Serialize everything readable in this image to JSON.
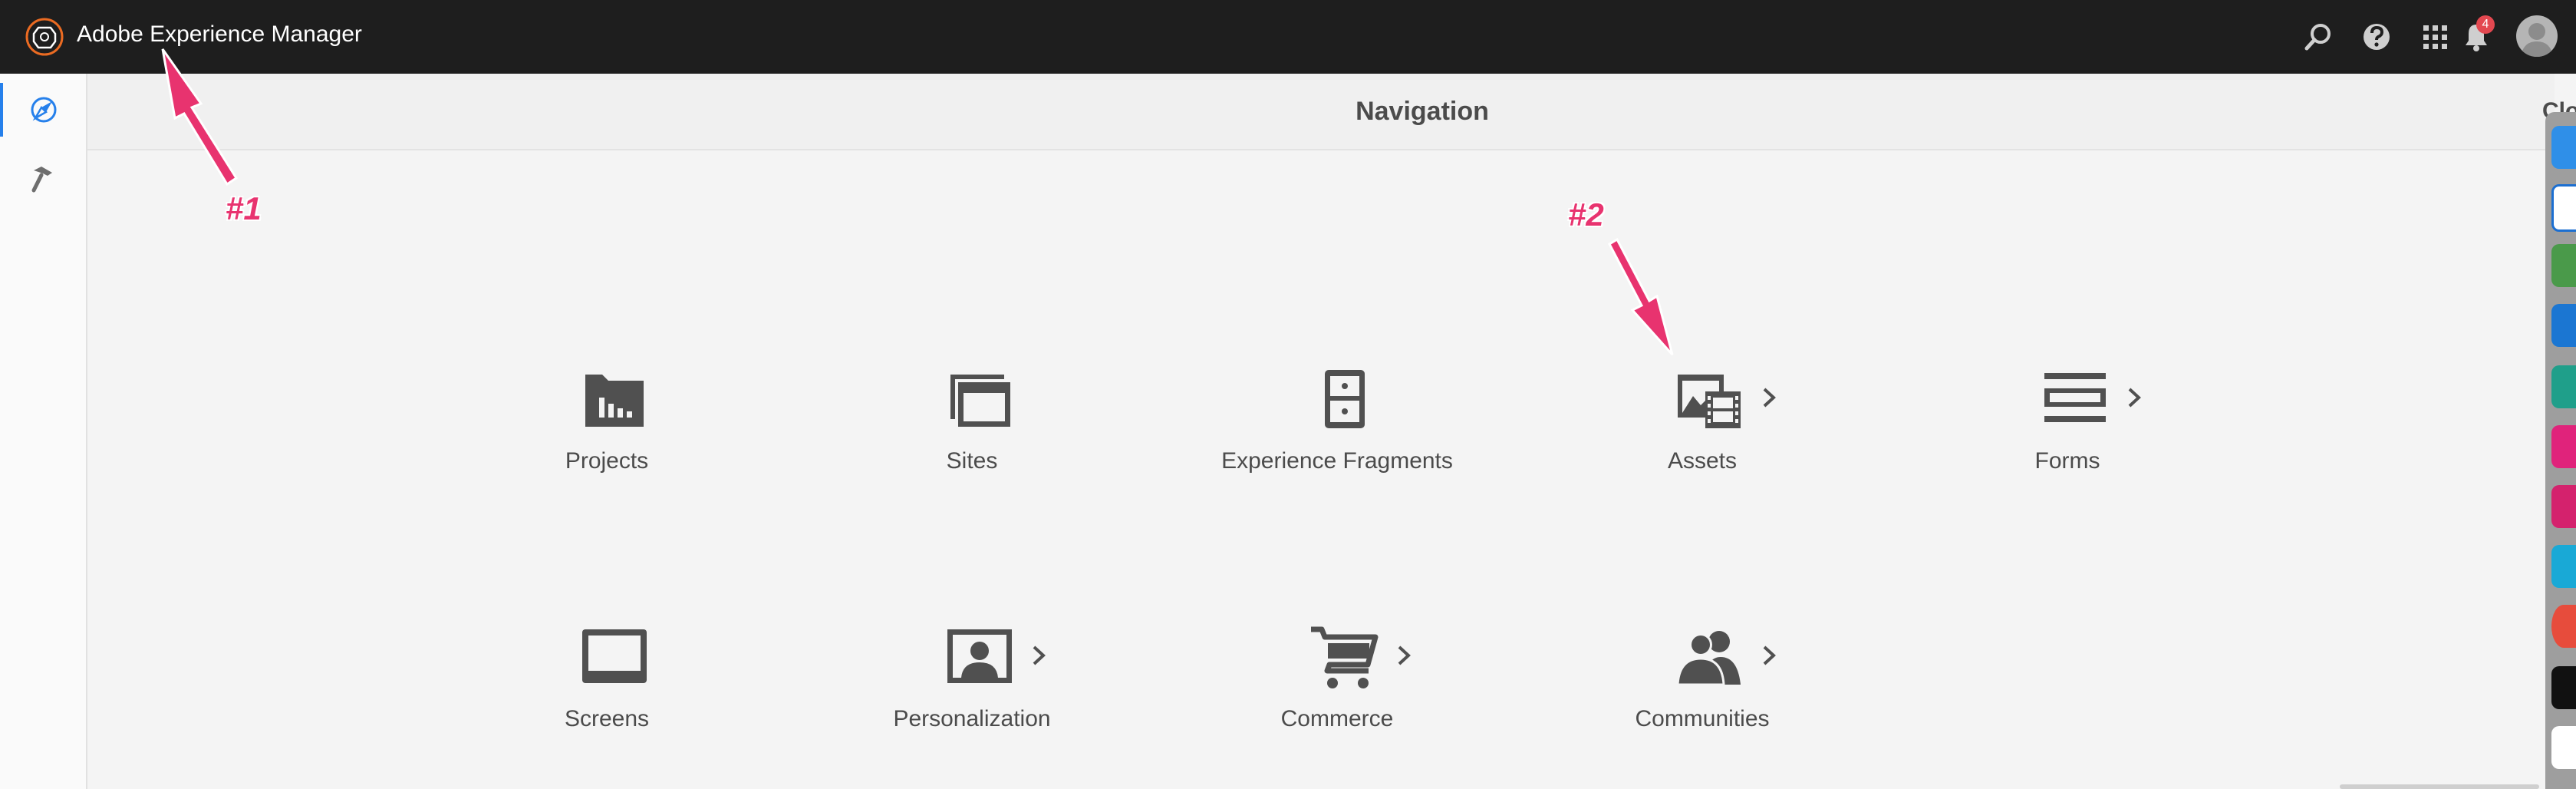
{
  "app": {
    "title": "Adobe Experience Manager"
  },
  "notifications": {
    "count": "4"
  },
  "panel": {
    "title": "Navigation",
    "close_label": "Close"
  },
  "tiles": [
    {
      "label": "Projects",
      "icon": "projects-icon",
      "has_submenu": false
    },
    {
      "label": "Sites",
      "icon": "sites-icon",
      "has_submenu": false
    },
    {
      "label": "Experience Fragments",
      "icon": "experience-fragments-icon",
      "has_submenu": false
    },
    {
      "label": "Assets",
      "icon": "assets-icon",
      "has_submenu": true
    },
    {
      "label": "Forms",
      "icon": "forms-icon",
      "has_submenu": true
    },
    {
      "label": "Screens",
      "icon": "screens-icon",
      "has_submenu": false
    },
    {
      "label": "Personalization",
      "icon": "personalization-icon",
      "has_submenu": true
    },
    {
      "label": "Commerce",
      "icon": "commerce-icon",
      "has_submenu": true
    },
    {
      "label": "Communities",
      "icon": "communities-icon",
      "has_submenu": true
    }
  ],
  "annotations": [
    {
      "label": "#1"
    },
    {
      "label": "#2"
    }
  ],
  "colors": {
    "topbar": "#1e1e1e",
    "accent": "#2680eb",
    "annotation": "#e8336f",
    "badge": "#e34850",
    "icon": "#505050"
  }
}
